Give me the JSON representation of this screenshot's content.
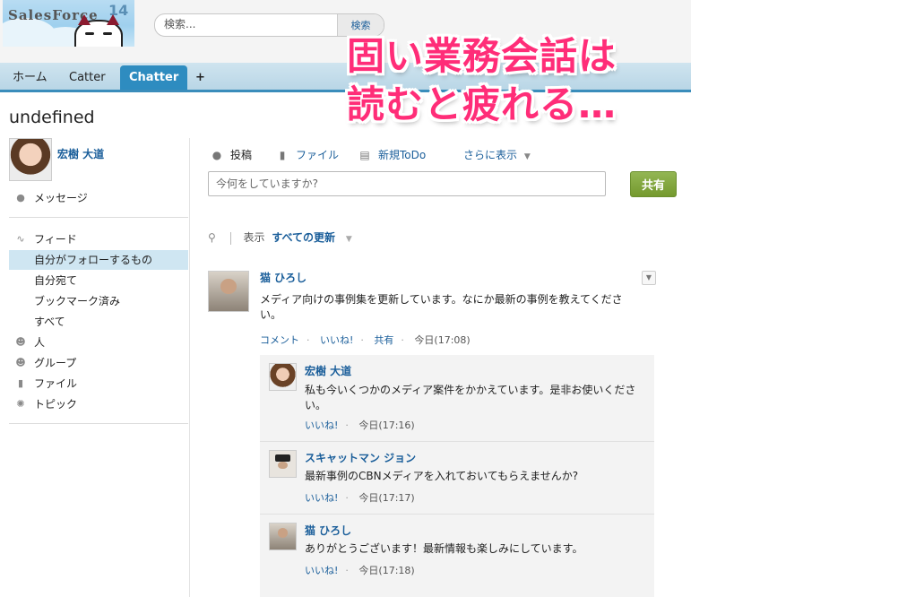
{
  "logo": {
    "text": "SalesForce",
    "number": "14"
  },
  "search": {
    "placeholder": "検索...",
    "button": "検索"
  },
  "tabs": [
    {
      "label": "ホーム"
    },
    {
      "label": "Catter"
    },
    {
      "label": "Chatter"
    },
    {
      "label": "+"
    }
  ],
  "banner": {
    "line1": "固い業務会話は",
    "line2": "読むと疲れる…"
  },
  "page_title": "undefined",
  "sidebar": {
    "user_name": "宏樹 大道",
    "messages": "メッセージ",
    "feed": "フィード",
    "feed_items": [
      "自分がフォローするもの",
      "自分宛て",
      "ブックマーク済み",
      "すべて"
    ],
    "people": "人",
    "groups": "グループ",
    "files": "ファイル",
    "topics": "トピック"
  },
  "publisher": {
    "post": "投稿",
    "file": "ファイル",
    "new_todo": "新規ToDo",
    "more": "さらに表示",
    "input_placeholder": "今何をしていますか?",
    "share": "共有"
  },
  "filter": {
    "label": "表示",
    "value": "すべての更新"
  },
  "post": {
    "author": "猫 ひろし",
    "line1": "メディア向けの事例集を更新しています。なにか最新の事例を教えてくださ",
    "line2": "い。",
    "comment": "コメント",
    "like": "いいね!",
    "share": "共有",
    "time": "今日(17:08)"
  },
  "comments": [
    {
      "author": "宏樹 大道",
      "line1": "私も今いくつかのメディア案件をかかえています。是非お使いくださ",
      "line2": "い。",
      "like": "いいね!",
      "time": "今日(17:16)"
    },
    {
      "author": "スキャットマン ジョン",
      "line1": "最新事例のCBNメディアを入れておいてもらえませんか?",
      "line2": "",
      "like": "いいね!",
      "time": "今日(17:17)"
    },
    {
      "author": "猫 ひろし",
      "line1": "ありがとうございます！最新情報も楽しみにしています。",
      "line2": "",
      "like": "いいね!",
      "time": "今日(17:18)"
    }
  ]
}
